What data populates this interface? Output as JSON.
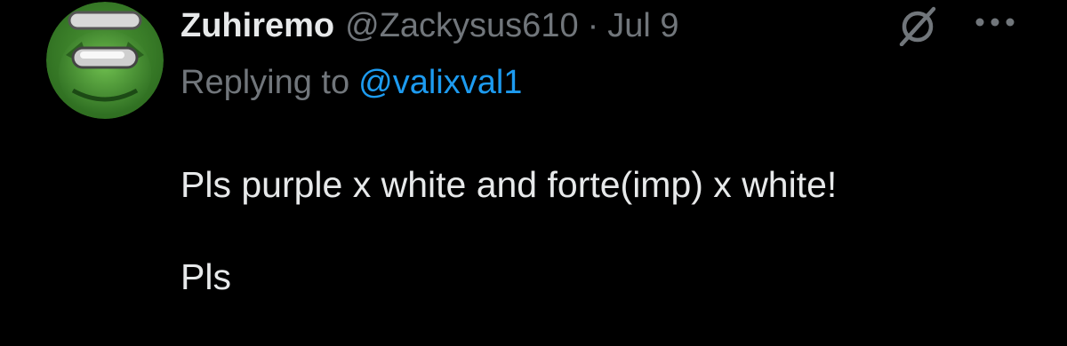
{
  "tweet": {
    "author": {
      "display_name": "Zuhiremo",
      "handle": "@Zackysus610"
    },
    "separator": "·",
    "date": "Jul 9",
    "reply": {
      "prefix": "Replying to",
      "handle": "@valixval1"
    },
    "text_line1": "Pls purple x white and forte(imp) x white!",
    "text_line2": "Pls"
  },
  "icons": {
    "avatar": "green-crewmate-avatar",
    "grok": "grok-icon",
    "more": "more-dots-icon"
  },
  "colors": {
    "background": "#000000",
    "primary_text": "#e7e9ea",
    "secondary_text": "#71767b",
    "link": "#1d9bf0",
    "avatar_green": "#3a7d2a"
  }
}
